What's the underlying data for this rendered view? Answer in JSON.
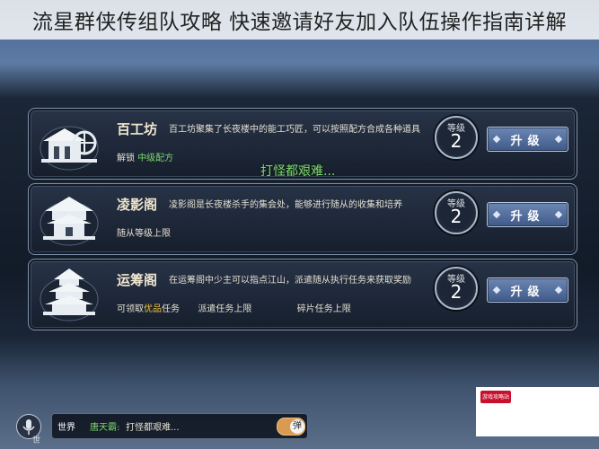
{
  "page_title": "流星群侠传组队攻略 快速邀请好友加入队伍操作指南详解",
  "buildings": [
    {
      "name": "百工坊",
      "icon": "workshop-icon",
      "description": "百工坊聚集了长夜楼中的能工巧匠，可以按照配方合成各种道具",
      "unlock_prefix": "解锁",
      "unlock_highlight": "中级配方",
      "unlock_extra": "",
      "level_label": "等级",
      "level": "2",
      "upgrade_label": "升级"
    },
    {
      "name": "凌影阁",
      "icon": "pavilion-icon",
      "description": "凌影阁是长夜楼杀手的集会处，能够进行随从的收集和培养",
      "unlock_prefix": "随从等级上限",
      "unlock_highlight": "",
      "unlock_extra": "",
      "level_label": "等级",
      "level": "2",
      "upgrade_label": "升级"
    },
    {
      "name": "运筹阁",
      "icon": "pagoda-icon",
      "description": "在运筹阁中少主可以指点江山，派遣随从执行任务来获取奖励",
      "unlock_prefix": "可领取",
      "unlock_highlight": "优品",
      "unlock_suffix": "任务",
      "unlock_mid": "派遣任务上限",
      "unlock_extra": "碎片任务上限",
      "level_label": "等级",
      "level": "2",
      "upgrade_label": "升级"
    }
  ],
  "floating_message": "打怪都艰难...",
  "chat": {
    "mic_label": "世",
    "channel": "世界",
    "sender": "唐天霸:",
    "message": "打怪都艰难...",
    "toggle_label": "弹"
  },
  "watermark_text": "游戏攻略站"
}
